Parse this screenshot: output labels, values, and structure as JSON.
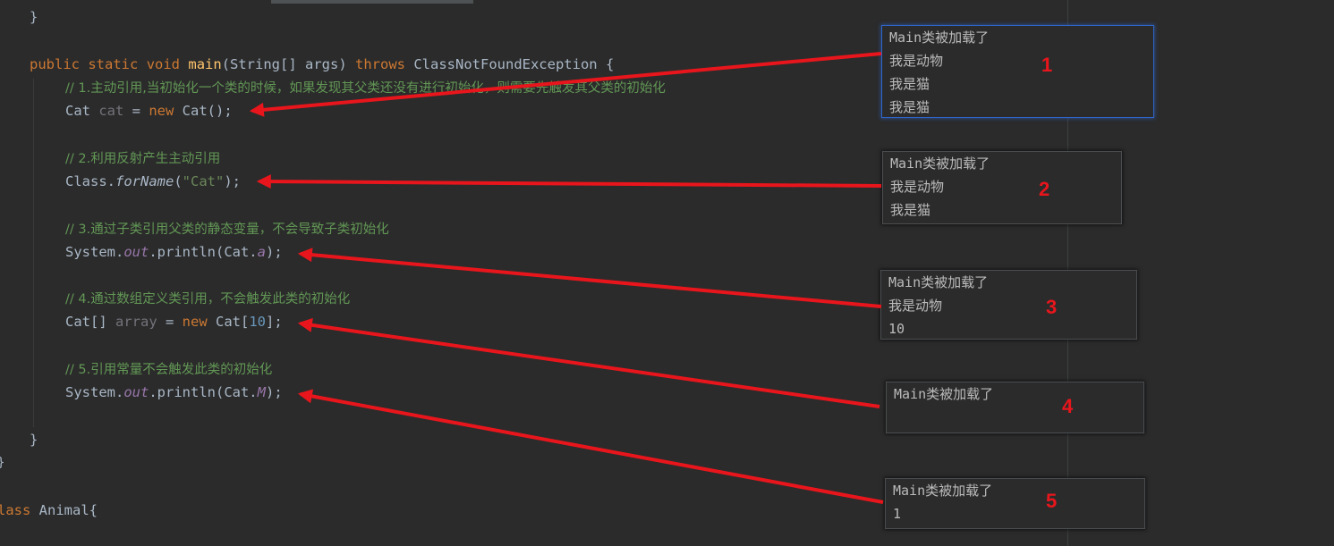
{
  "code": {
    "close_brace_top": "}",
    "main_sig": {
      "kw_public": "public",
      "kw_static": "static",
      "kw_void": "void",
      "method_name": "main",
      "params_open": "(String[] args) ",
      "kw_throws": "throws",
      "exception": " ClassNotFoundException {"
    },
    "comment1": "// 1.主动引用,当初始化一个类的时候，如果发现其父类还没有进行初始化，则需要先触发其父类的初始化",
    "line1": {
      "type": "Cat ",
      "var": "cat",
      "eq": " = ",
      "kw_new": "new",
      "rest": " Cat();"
    },
    "comment2": "// 2.利用反射产生主动引用",
    "line2": {
      "pre": "Class.",
      "method": "forName",
      "open": "(",
      "str": "\"Cat\"",
      "close": ");"
    },
    "comment3": "// 3.通过子类引用父类的静态变量，不会导致子类初始化",
    "line3": {
      "pre": "System.",
      "field": "out",
      "mid": ".println(Cat.",
      "static_field": "a",
      "close": ");"
    },
    "comment4": "// 4.通过数组定义类引用，不会触发此类的初始化",
    "line4": {
      "type": "Cat[] ",
      "var": "array",
      "eq": " = ",
      "kw_new": "new",
      "type2": " Cat[",
      "num": "10",
      "close": "];"
    },
    "comment5": "// 5.引用常量不会触发此类的初始化",
    "line5": {
      "pre": "System.",
      "field": "out",
      "mid": ".println(Cat.",
      "const": "M",
      "close": ");"
    },
    "close_brace_main": "}",
    "close_brace_class": "}",
    "class_decl": {
      "kw": "lass",
      "rest": " Animal{"
    }
  },
  "outputs": [
    {
      "marker": "1",
      "lines": [
        "Main类被加载了",
        "我是动物",
        "我是猫",
        "我是猫"
      ]
    },
    {
      "marker": "2",
      "lines": [
        "Main类被加载了",
        "我是动物",
        "我是猫"
      ]
    },
    {
      "marker": "3",
      "lines": [
        "Main类被加载了",
        "我是动物",
        "10"
      ]
    },
    {
      "marker": "4",
      "lines": [
        "Main类被加载了"
      ]
    },
    {
      "marker": "5",
      "lines": [
        "Main类被加载了",
        "1"
      ]
    }
  ],
  "colors": {
    "background": "#2b2b2b",
    "keyword": "#cc7832",
    "method": "#ffc66d",
    "string": "#6a8759",
    "number": "#6897bb",
    "comment": "#629755",
    "static_field": "#9876aa",
    "annotation_red": "#e8161c",
    "selection_border": "#2f65ca"
  }
}
